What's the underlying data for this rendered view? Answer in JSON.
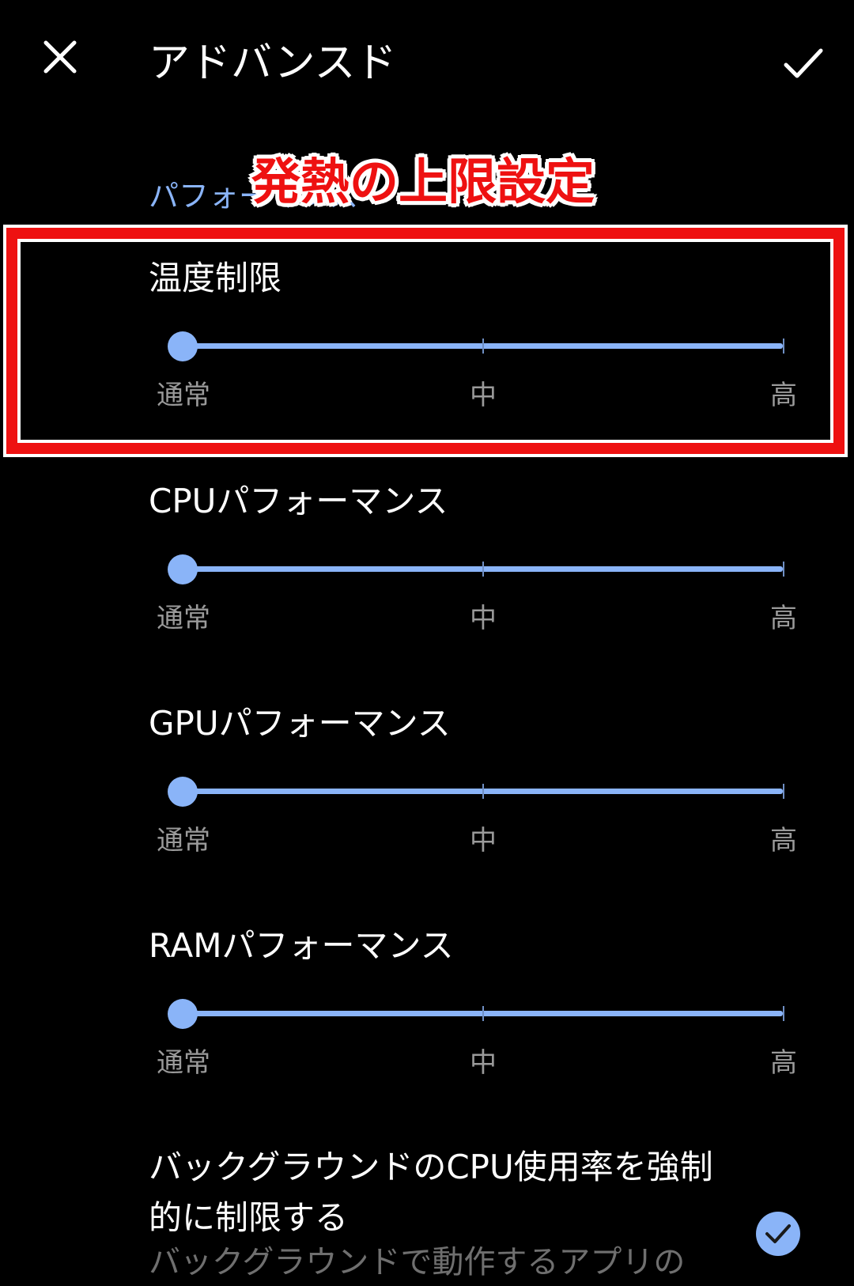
{
  "header": {
    "title": "アドバンスド",
    "close_icon": "close-icon",
    "confirm_icon": "check-icon"
  },
  "annotation": {
    "label": "発熱の上限設定",
    "color": "#ee1111"
  },
  "section": {
    "header": "パフォーマンス"
  },
  "settings": [
    {
      "title": "温度制限",
      "labels": [
        "通常",
        "中",
        "高"
      ],
      "value": "通常",
      "level": 0
    },
    {
      "title": "CPUパフォーマンス",
      "labels": [
        "通常",
        "中",
        "高"
      ],
      "value": "通常",
      "level": 0
    },
    {
      "title": "GPUパフォーマンス",
      "labels": [
        "通常",
        "中",
        "高"
      ],
      "value": "通常",
      "level": 0
    },
    {
      "title": "RAMパフォーマンス",
      "labels": [
        "通常",
        "中",
        "高"
      ],
      "value": "通常",
      "level": 0
    }
  ],
  "background_cpu": {
    "title": "バックグラウンドのCPU使用率を強制的に制限する",
    "description": "バックグラウンドで動作するアプリの",
    "checked": true
  },
  "colors": {
    "accent": "#8ab4f8",
    "background": "#000000",
    "secondary_text": "#9a9a9a"
  }
}
